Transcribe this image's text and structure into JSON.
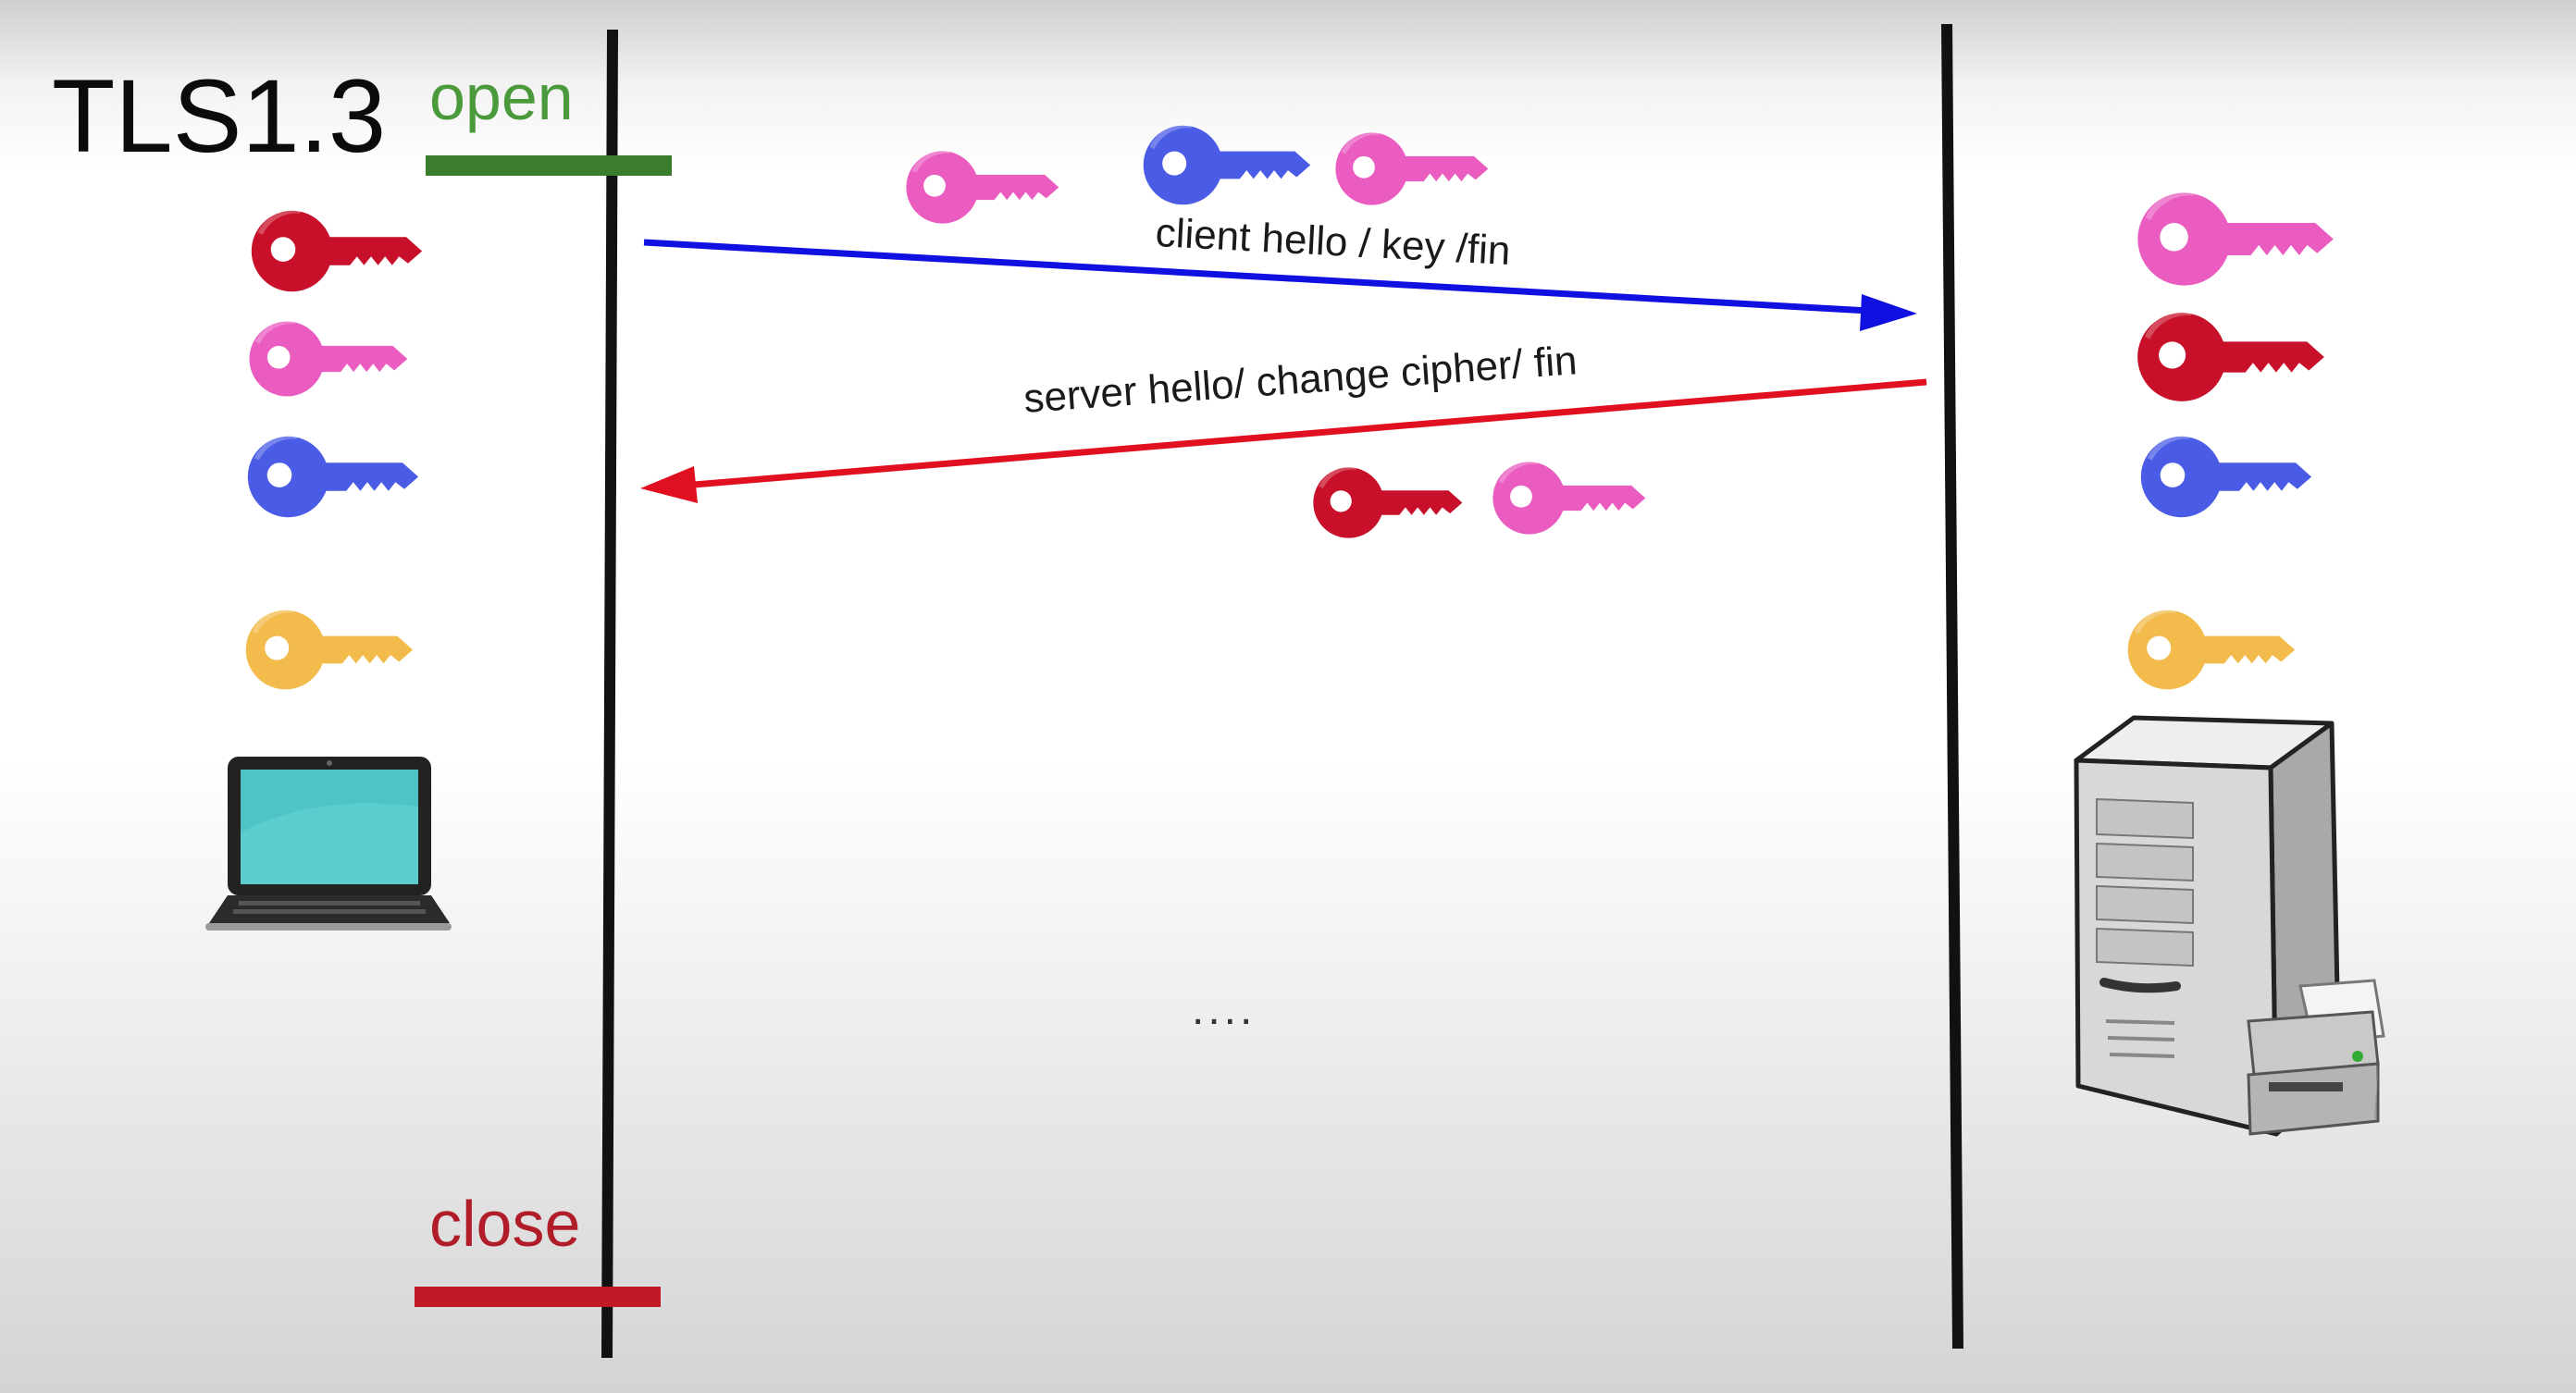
{
  "diagram": {
    "title": "TLS1.3",
    "open_label": "open",
    "close_label": "close",
    "client_message": "client hello / key /fin",
    "server_message": "server hello/ change cipher/ fin",
    "ellipsis": "....",
    "colors": {
      "open_bar": "#3a7d2c",
      "close_bar": "#c01a27",
      "client_arrow": "#1010e0",
      "server_arrow": "#e01020",
      "key_red": "#c8102a",
      "key_pink": "#ea5cc0",
      "key_blue": "#4a5be6",
      "key_yellow": "#f2bb4c",
      "lifeline": "#111111"
    },
    "icons": {
      "client_device": "laptop-icon",
      "server_device": "server-tower-icon",
      "printer": "printer-icon"
    }
  }
}
